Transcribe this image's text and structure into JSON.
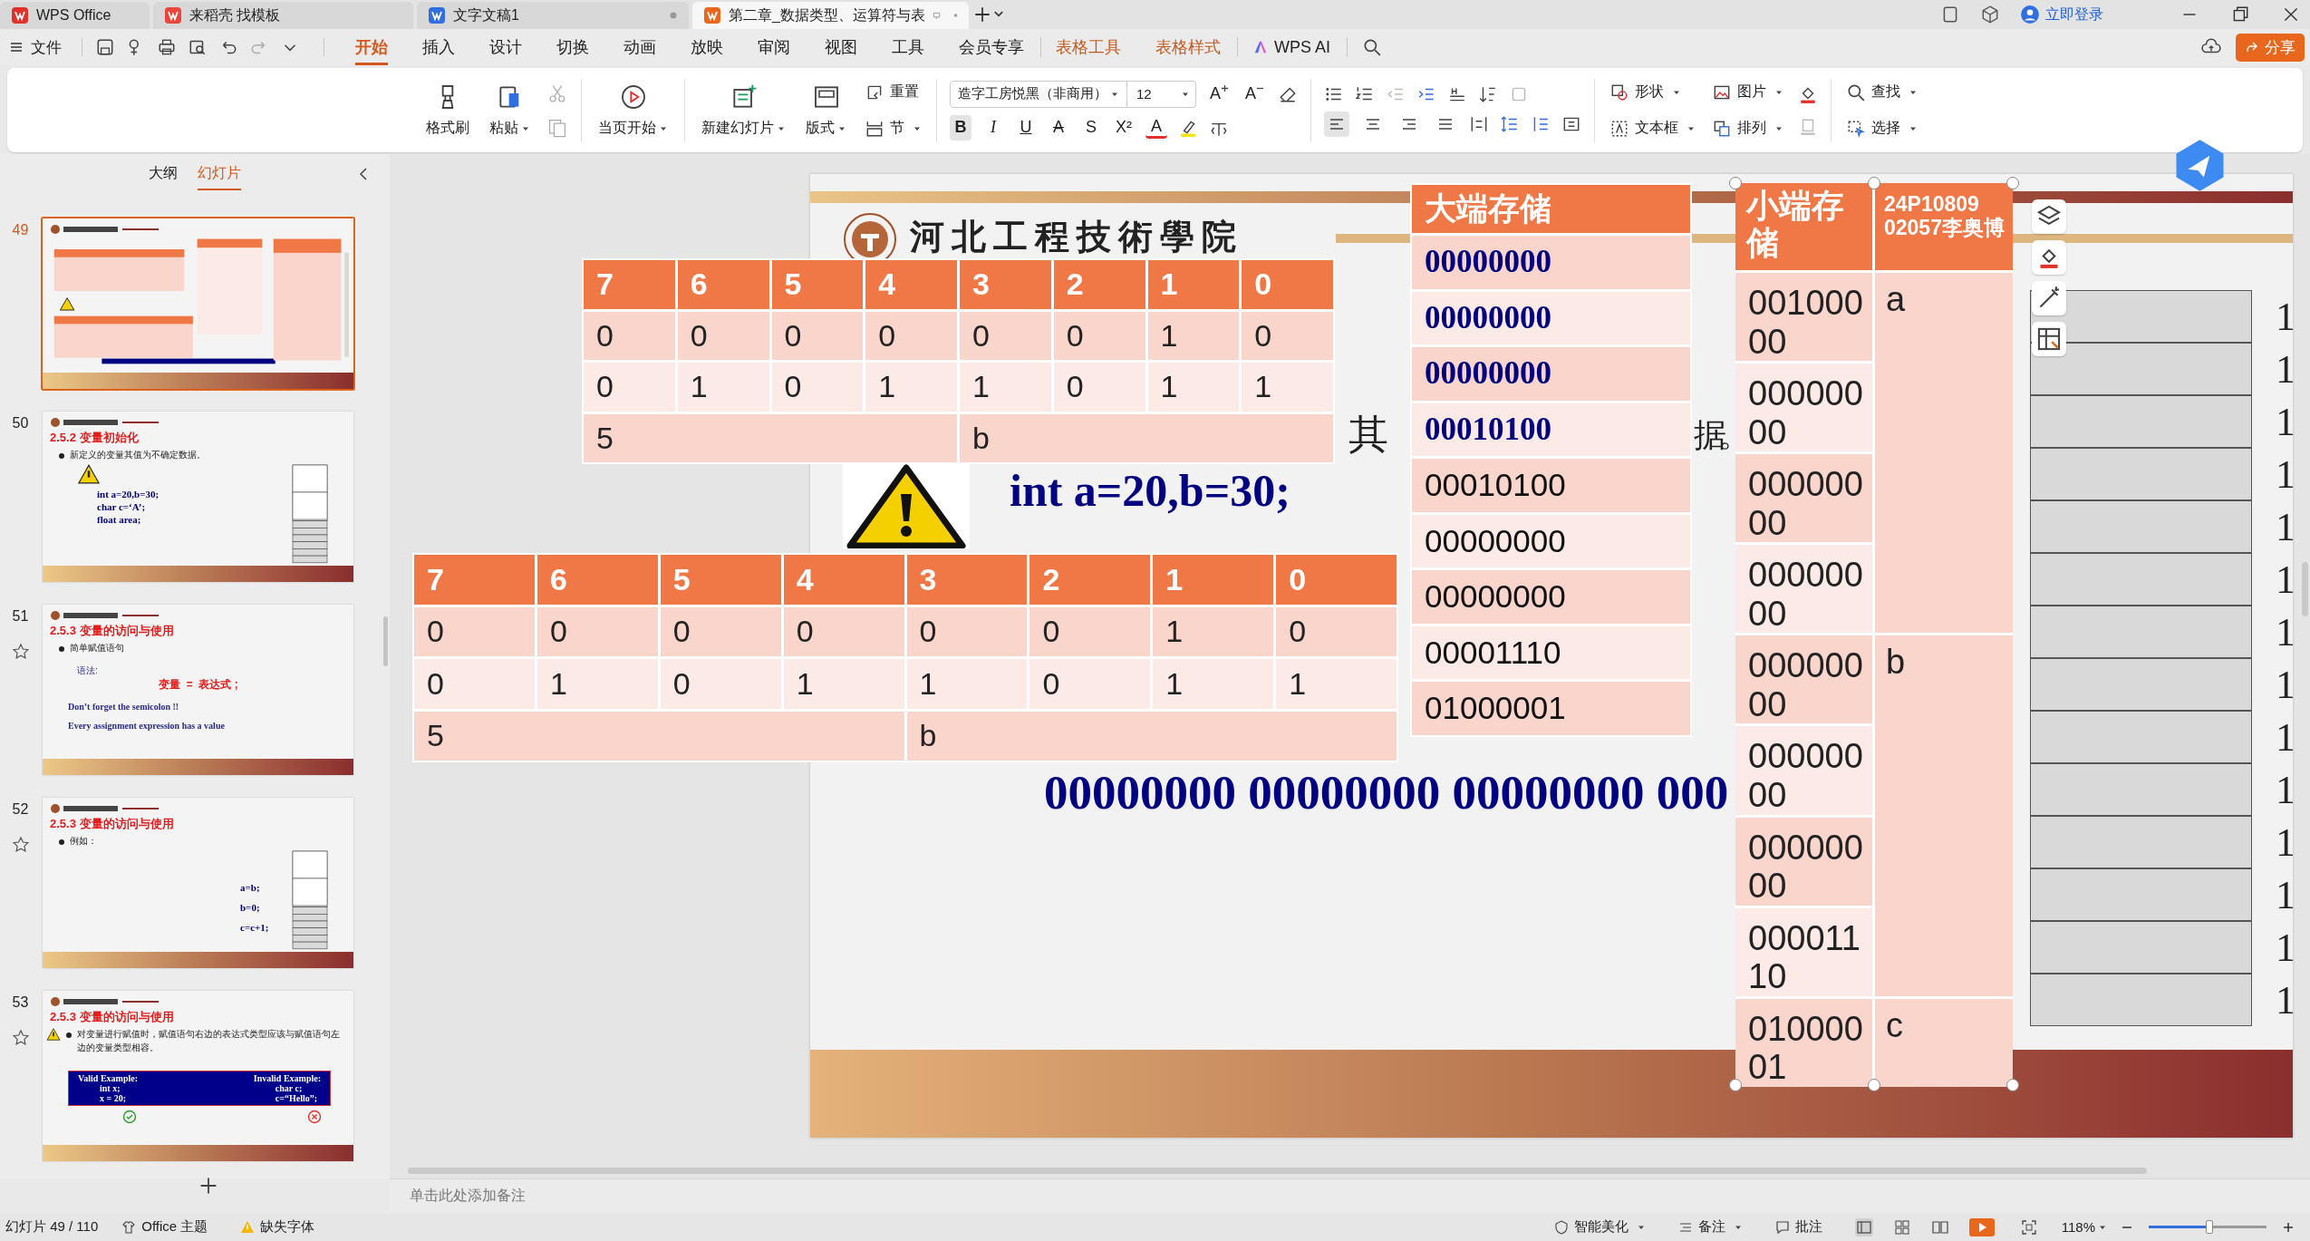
{
  "title_bar": {
    "tabs": [
      {
        "label": "WPS Office",
        "kind": "home",
        "selected": false,
        "unsaved": false
      },
      {
        "label": "来稻壳 找模板",
        "kind": "template",
        "selected": false,
        "unsaved": false
      },
      {
        "label": "文字文稿1",
        "kind": "writer",
        "selected": false,
        "unsaved": true
      },
      {
        "label": "第二章_数据类型、运算符与表",
        "kind": "presentation",
        "selected": true,
        "unsaved": true
      }
    ],
    "login": "立即登录"
  },
  "menu": {
    "file": "文件",
    "tabs": [
      {
        "label": "开始",
        "kind": "normal",
        "selected": true
      },
      {
        "label": "插入",
        "kind": "normal",
        "selected": false
      },
      {
        "label": "设计",
        "kind": "normal",
        "selected": false
      },
      {
        "label": "切换",
        "kind": "normal",
        "selected": false
      },
      {
        "label": "动画",
        "kind": "normal",
        "selected": false
      },
      {
        "label": "放映",
        "kind": "normal",
        "selected": false
      },
      {
        "label": "审阅",
        "kind": "normal",
        "selected": false
      },
      {
        "label": "视图",
        "kind": "normal",
        "selected": false
      },
      {
        "label": "工具",
        "kind": "normal",
        "selected": false
      },
      {
        "label": "会员专享",
        "kind": "normal",
        "selected": false
      },
      {
        "label": "表格工具",
        "kind": "context",
        "selected": false
      },
      {
        "label": "表格样式",
        "kind": "context",
        "selected": false
      },
      {
        "label": "WPS AI",
        "kind": "ai",
        "selected": false
      }
    ],
    "share": "分享"
  },
  "ribbon": {
    "format_painter": "格式刷",
    "paste": "粘贴",
    "start_from_current": "当页开始",
    "new_slide": "新建幻灯片",
    "layout": "版式",
    "reset": "重置",
    "section": "节",
    "font": "造字工房悦黑（非商用）",
    "font_size": "12",
    "font_size_buttons": [
      "A",
      "A"
    ],
    "format_buttons": [
      {
        "label": "B",
        "selected": true
      },
      {
        "label": "I",
        "selected": false
      },
      {
        "label": "U",
        "selected": false
      },
      {
        "label": "A",
        "selected": false
      },
      {
        "label": "S",
        "selected": false
      },
      {
        "label": "X²",
        "selected": false
      },
      {
        "label": "A",
        "selected": false
      }
    ],
    "align_buttons": [
      {
        "selected": true
      },
      {
        "selected": false
      },
      {
        "selected": false
      },
      {
        "selected": false
      }
    ],
    "shape": "形状",
    "picture": "图片",
    "text_box": "文本框",
    "arrange": "排列",
    "find": "查找",
    "select": "选择"
  },
  "left_panel": {
    "tabs": [
      {
        "label": "大纲",
        "selected": false
      },
      {
        "label": "幻灯片",
        "selected": true
      }
    ],
    "thumbnails": [
      {
        "number": "49",
        "kind": "overview",
        "selected": true,
        "star": false
      },
      {
        "number": "50",
        "kind": "memory",
        "selected": false,
        "star": false,
        "warning": true,
        "heading": "2.5.2  变量初始化",
        "bullet": "新定义的变量其值为不确定数据。",
        "lines": [
          "int a=20,b=30;",
          "char c=‘A’;",
          "float area;"
        ]
      },
      {
        "number": "51",
        "kind": "syntax",
        "selected": false,
        "star": true,
        "warning": false,
        "heading": "2.5.3  变量的访问与使用",
        "bullet": "简单赋值语句",
        "label": "语法:",
        "formula": "变量  =  表达式 ;",
        "lines": [
          "Don’t forget the semicolon !!",
          "Every assignment expression has a value"
        ]
      },
      {
        "number": "52",
        "kind": "memory",
        "selected": false,
        "star": true,
        "warning": false,
        "heading": "2.5.3  变量的访问与使用",
        "bullet": "例如：",
        "lines": [
          "a=b;",
          "b=0;",
          "c=c+1;"
        ]
      },
      {
        "number": "53",
        "kind": "examples",
        "selected": false,
        "star": true,
        "warning": true,
        "heading": "2.5.3  变量的访问与使用",
        "bullet": "对变量进行赋值时，赋值语句右边的表达式类型应该与赋值语句左边的变量类型相容。",
        "valid": {
          "title": "Valid Example:",
          "lines": [
            "int x;",
            "x = 20;"
          ]
        },
        "invalid": {
          "title": "Invalid Example:",
          "lines": [
            "char c;",
            "c=“Hello”;"
          ]
        }
      }
    ]
  },
  "slide": {
    "college": "河北工程技術學院",
    "fragments": [
      "其",
      "据。"
    ],
    "code": [
      "int a=20,b=30;"
    ],
    "binary_line": "00000000 00000000 00000000 000",
    "address_labels": [
      "1",
      "1",
      "1",
      "1",
      "1",
      "1",
      "1",
      "1",
      "1",
      "1",
      "1",
      "1",
      "1",
      "1"
    ]
  },
  "bit_tables": [
    {
      "header": [
        "7",
        "6",
        "5",
        "4",
        "3",
        "2",
        "1",
        "0"
      ],
      "rows": [
        [
          "0",
          "0",
          "0",
          "0",
          "0",
          "0",
          "1",
          "0"
        ],
        [
          "0",
          "1",
          "0",
          "1",
          "1",
          "0",
          "1",
          "1"
        ]
      ],
      "footer": [
        "5",
        "b"
      ]
    },
    {
      "header": [
        "7",
        "6",
        "5",
        "4",
        "3",
        "2",
        "1",
        "0"
      ],
      "rows": [
        [
          "0",
          "0",
          "0",
          "0",
          "0",
          "0",
          "1",
          "0"
        ],
        [
          "0",
          "1",
          "0",
          "1",
          "1",
          "0",
          "1",
          "1"
        ]
      ],
      "footer": [
        "5",
        "b"
      ]
    }
  ],
  "big_endian": {
    "header": "大端存储",
    "rows": [
      {
        "text": "00000000",
        "kind": "emphasis"
      },
      {
        "text": "00000000",
        "kind": "emphasis"
      },
      {
        "text": "00000000",
        "kind": "emphasis"
      },
      {
        "text": "00010100",
        "kind": "emphasis"
      },
      {
        "text": "00010100",
        "kind": "plain"
      },
      {
        "text": "00000000",
        "kind": "plain"
      },
      {
        "text": "00000000",
        "kind": "plain"
      },
      {
        "text": "00001110",
        "kind": "plain"
      },
      {
        "text": "01000001",
        "kind": "plain"
      }
    ]
  },
  "little_endian": {
    "header": [
      "小端存储",
      "24P10809 02057李奥博"
    ],
    "variables": [
      {
        "name": "a",
        "bytes": [
          "00100000",
          "00000000",
          "00000000",
          "00000000"
        ]
      },
      {
        "name": "b",
        "bytes": [
          "00000000",
          "00000000",
          "00000000",
          "00001110"
        ]
      },
      {
        "name": "c",
        "bytes": [
          "01000001"
        ]
      }
    ]
  },
  "notes": {
    "placeholder": "单击此处添加备注"
  },
  "status_bar": {
    "slide_info": "幻灯片 49 / 110",
    "theme": "Office 主题",
    "missing_fonts": "缺失字体",
    "beautify": "智能美化",
    "notes": "备注",
    "comments": "批注",
    "zoom": "118%",
    "level": 0.51
  }
}
